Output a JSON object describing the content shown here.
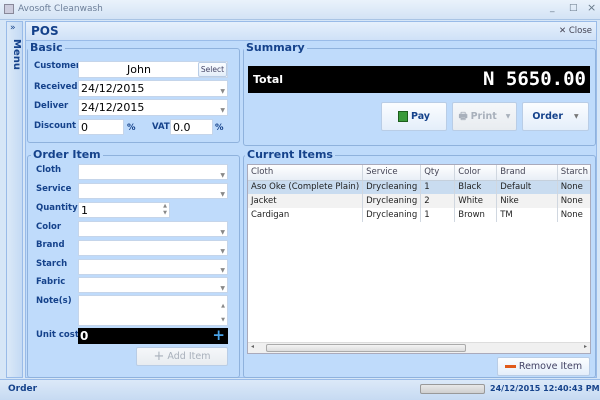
{
  "window": {
    "title": "Avosoft Cleanwash",
    "minimize": "_",
    "maximize": "□",
    "close": "×"
  },
  "menu": {
    "label": "Menu",
    "expand": "»"
  },
  "pos": {
    "title": "POS",
    "close_label": "Close"
  },
  "basic": {
    "title": "Basic",
    "customer_label": "Customer",
    "customer_value": "John",
    "select_label": "Select",
    "received_label": "Received",
    "received_value": "24/12/2015",
    "deliver_label": "Deliver",
    "deliver_value": "24/12/2015",
    "discount_label": "Discount",
    "discount_value": "0",
    "discount_unit": "%",
    "vat_label": "VAT",
    "vat_value": "0.0",
    "vat_unit": "%"
  },
  "summary": {
    "title": "Summary",
    "total_label": "Total",
    "total_value": "N 5650.00",
    "pay_label": "Pay",
    "print_label": "Print",
    "order_label": "Order"
  },
  "order_item": {
    "title": "Order Item",
    "cloth_label": "Cloth",
    "service_label": "Service",
    "quantity_label": "Quantity",
    "quantity_value": "1",
    "color_label": "Color",
    "brand_label": "Brand",
    "starch_label": "Starch",
    "fabric_label": "Fabric",
    "notes_label": "Note(s)",
    "unit_cost_label": "Unit cost",
    "unit_cost_value": "0",
    "add_item_label": "Add Item"
  },
  "current_items": {
    "title": "Current Items",
    "columns": [
      "Cloth",
      "Service",
      "Qty",
      "Color",
      "Brand",
      "Starch"
    ],
    "rows": [
      [
        "Aso Oke (Complete Plain)",
        "Drycleaning",
        "1",
        "Black",
        "Default",
        "None"
      ],
      [
        "Jacket",
        "Drycleaning",
        "2",
        "White",
        "Nike",
        "None"
      ],
      [
        "Cardigan",
        "Drycleaning",
        "1",
        "Brown",
        "TM",
        "None"
      ]
    ],
    "remove_label": "Remove Item"
  },
  "status": {
    "label": "Order",
    "datetime": "24/12/2015 12:40:43 PM"
  }
}
